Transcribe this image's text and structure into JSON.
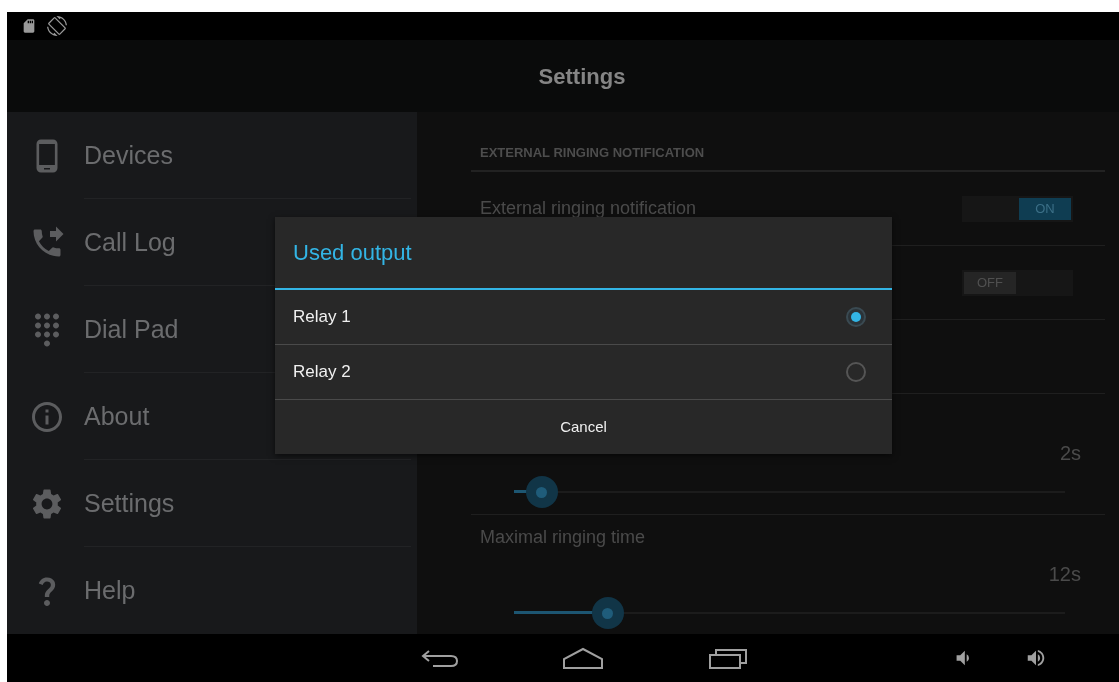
{
  "action_bar": {
    "title": "Settings"
  },
  "sidebar": {
    "items": [
      {
        "label": "Devices"
      },
      {
        "label": "Call Log"
      },
      {
        "label": "Dial Pad"
      },
      {
        "label": "About"
      },
      {
        "label": "Settings"
      },
      {
        "label": "Help"
      }
    ]
  },
  "content": {
    "header": "EXTERNAL RINGING NOTIFICATION",
    "rows": [
      {
        "kind": "switch",
        "label": "External ringing notification",
        "switch": {
          "on": true,
          "text": "ON"
        }
      },
      {
        "kind": "switch",
        "switch": {
          "on": false,
          "text": "OFF"
        }
      },
      {
        "kind": "blank"
      },
      {
        "kind": "slider",
        "value": "2s",
        "level": 0.05
      },
      {
        "kind": "slider",
        "label": "Maximal ringing time",
        "value": "12s",
        "level": 0.17
      }
    ]
  },
  "dialog": {
    "title": "Used output",
    "options": [
      {
        "label": "Relay 1",
        "selected": true
      },
      {
        "label": "Relay 2",
        "selected": false
      }
    ],
    "cancel": "Cancel"
  }
}
